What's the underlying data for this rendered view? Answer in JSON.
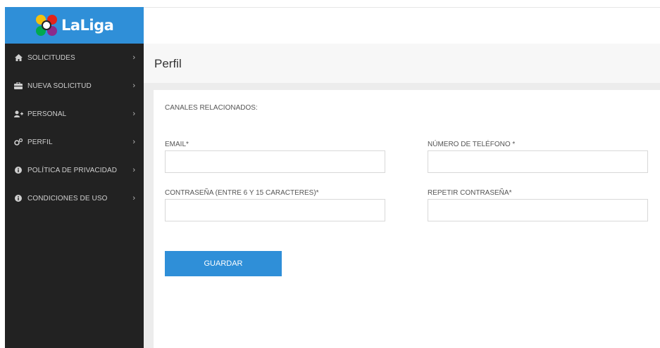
{
  "brand": {
    "logo_text": "LaLiga"
  },
  "sidebar": {
    "items": [
      {
        "label": "SOLICITUDES",
        "icon": "home-icon"
      },
      {
        "label": "NUEVA SOLICITUD",
        "icon": "briefcase-icon"
      },
      {
        "label": "PERSONAL",
        "icon": "user-plus-icon"
      },
      {
        "label": "PERFIL",
        "icon": "cogs-icon"
      },
      {
        "label": "POLÍTICA DE PRIVACIDAD",
        "icon": "info-circle-icon"
      },
      {
        "label": "CONDICIONES DE USO",
        "icon": "info-circle-icon"
      }
    ]
  },
  "page": {
    "title": "Perfil"
  },
  "form": {
    "section_title": "CANALES RELACIONADOS:",
    "email_label": "EMAIL*",
    "email_value": "",
    "phone_label": "NÚMERO DE TELÉFONO *",
    "phone_value": "",
    "password_label": "CONTRASEÑA (ENTRE 6 Y 15 CARACTERES)*",
    "password_value": "",
    "repeat_password_label": "REPETIR CONTRASEÑA*",
    "repeat_password_value": "",
    "save_label": "GUARDAR"
  },
  "colors": {
    "sidebar_bg": "#222222",
    "brand_blue": "#2f8fd8",
    "header_bg": "#f7f7f7"
  }
}
